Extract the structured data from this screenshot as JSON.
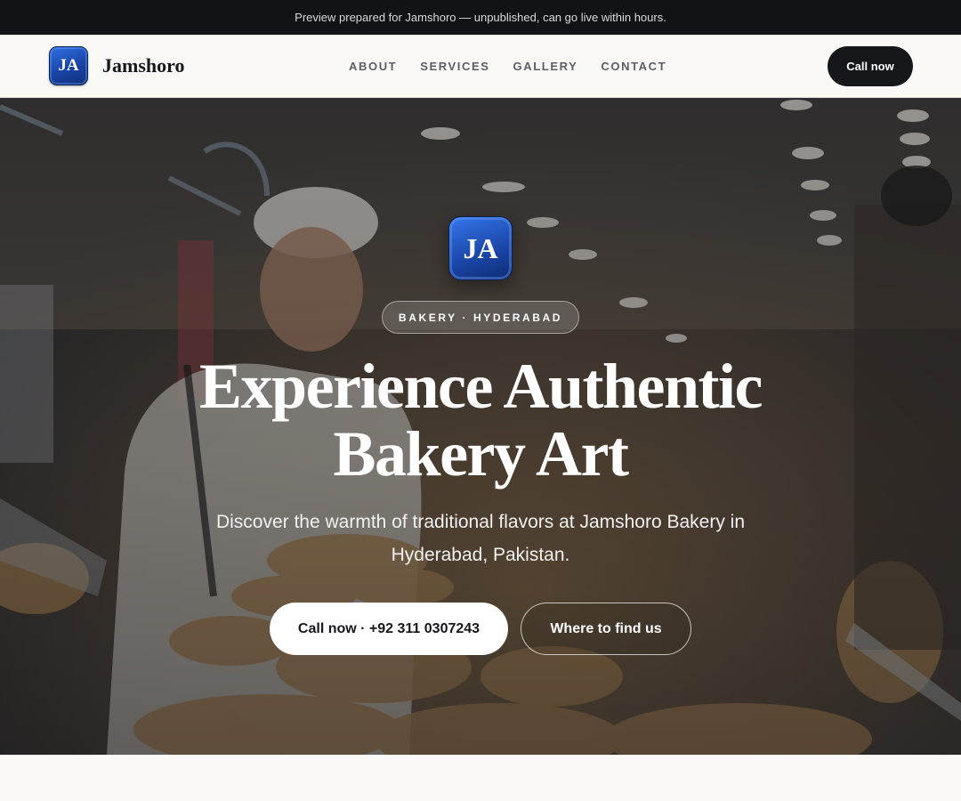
{
  "announcement": "Preview prepared for Jamshoro — unpublished, can go live within hours.",
  "brand": {
    "initials": "JA",
    "name": "Jamshoro"
  },
  "nav": {
    "links": [
      "ABOUT",
      "SERVICES",
      "GALLERY",
      "CONTACT"
    ],
    "cta": "Call now"
  },
  "hero": {
    "logo_initials": "JA",
    "eyebrow": "BAKERY · HYDERABAD",
    "title_line1": "Experience Authentic",
    "title_line2": "Bakery Art",
    "subtitle": "Discover the warmth of traditional flavors at Jamshoro Bakery in Hyderabad, Pakistan.",
    "primary_cta": "Call now · +92 311 0307243",
    "secondary_cta": "Where to find us"
  },
  "colors": {
    "topbar": "#111317",
    "nav_bg": "#faf9f6",
    "dark_button": "#15171b",
    "logo_blue": "#1a45a8"
  }
}
